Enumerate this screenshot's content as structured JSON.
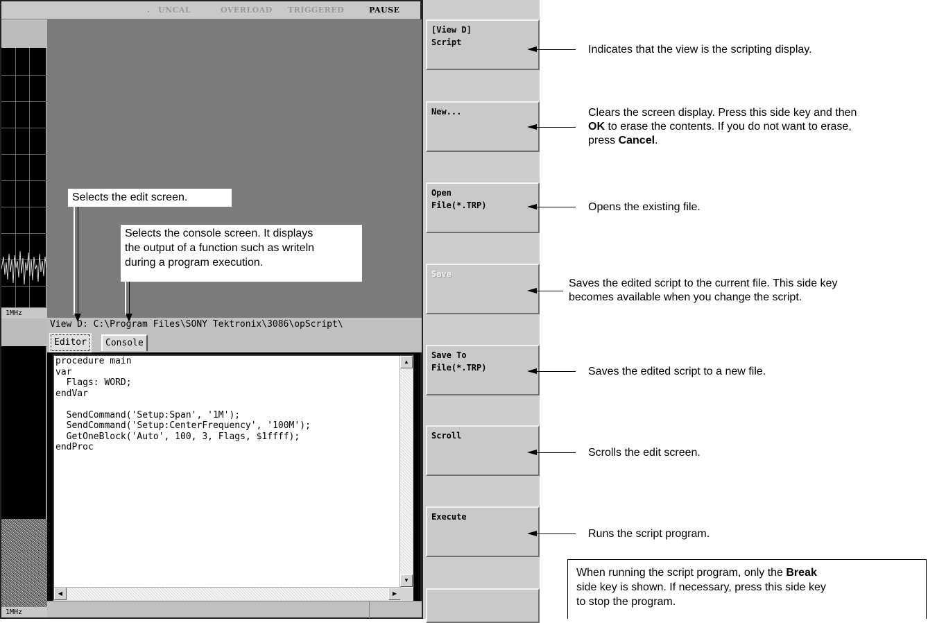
{
  "status": {
    "uncal": "UNCAL",
    "overload": "OVERLOAD",
    "triggered": "TRIGGERED",
    "pause": "PAUSE"
  },
  "left_strip": {
    "freq_top": "1MHz",
    "freq_bottom": "1MHz"
  },
  "view_path": "View D: C:\\Program Files\\SONY Tektronix\\3086\\opScript\\",
  "tabs": [
    {
      "label": "Editor",
      "active": true
    },
    {
      "label": "Console",
      "active": false
    }
  ],
  "editor_code": "procedure main\nvar\n  Flags: WORD;\nendVar\n\n  SendCommand('Setup:Span', '1M');\n  SendCommand('Setup:CenterFrequency', '100M');\n  GetOneBlock('Auto', 100, 3, Flags, $1ffff);\nendProc",
  "screen_callouts": {
    "editor": "Selects the edit screen.",
    "console_1": "Selects the console screen. It displays",
    "console_2": "the output of a function such as writeln",
    "console_3": "during a program execution."
  },
  "side_keys": [
    {
      "line1": "[View D]",
      "line2": "Script",
      "enabled": true
    },
    {
      "line1": "New...",
      "line2": "",
      "enabled": true
    },
    {
      "line1": "Open",
      "line2": "File(*.TRP)",
      "enabled": true
    },
    {
      "line1": "Save",
      "line2": "",
      "enabled": false
    },
    {
      "line1": "Save To",
      "line2": "File(*.TRP)",
      "enabled": true
    },
    {
      "line1": "Scroll",
      "line2": "",
      "enabled": true
    },
    {
      "line1": "Execute",
      "line2": "",
      "enabled": true
    }
  ],
  "annotations": {
    "view": "Indicates that the view is the scripting display.",
    "new_1": "Clears the screen display. Press this side key and then",
    "new_2_bold": "OK",
    "new_2_rest": " to erase the contents. If you do not want to erase,",
    "new_3_pre": "press ",
    "new_3_bold": "Cancel",
    "new_3_post": ".",
    "open": "Opens the existing file.",
    "save_1": "Saves the edited script to the current file. This side key",
    "save_2": "becomes available when you change the script.",
    "saveto": "Saves the edited script to a new file.",
    "scroll": "Scrolls the edit screen.",
    "execute": "Runs the script program."
  },
  "note": {
    "l1_pre": "When running the script program, only the ",
    "l1_bold": "Break",
    "l2": "side key is shown. If necessary, press this side key",
    "l3": "to stop the program."
  }
}
